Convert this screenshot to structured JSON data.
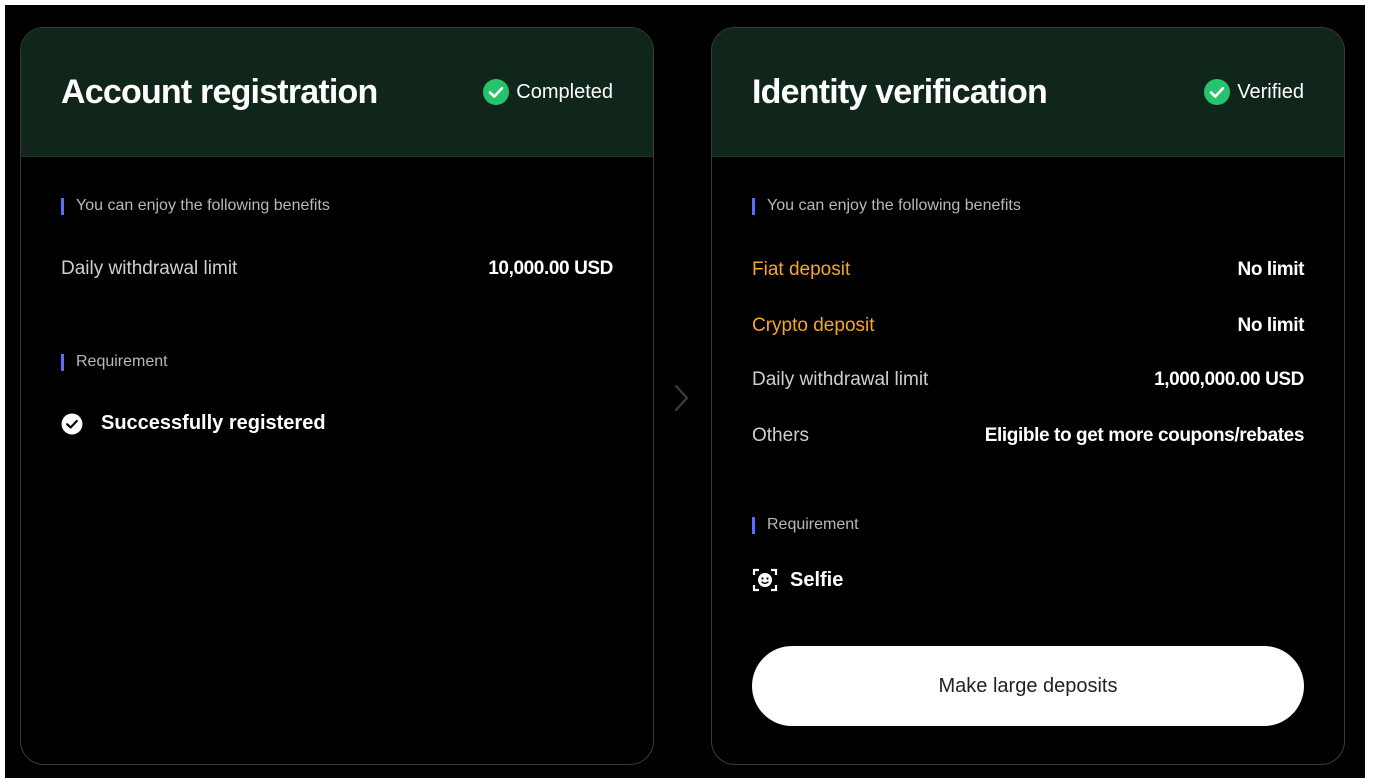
{
  "colors": {
    "header_bg": "#10261a",
    "accent_orange": "#f5a623",
    "accent_bar": "#5b6cff",
    "status_green": "#27c26c"
  },
  "cards": [
    {
      "title": "Account registration",
      "status": "Completed",
      "benefits_heading": "You can enjoy the following benefits",
      "benefits": [
        {
          "label": "Daily withdrawal limit",
          "value": "10,000.00 USD"
        }
      ],
      "requirement_heading": "Requirement",
      "requirement": {
        "label": "Successfully registered",
        "icon": "check-circle-icon"
      }
    },
    {
      "title": "Identity verification",
      "status": "Verified",
      "benefits_heading": "You can enjoy the following benefits",
      "benefits": [
        {
          "label": "Fiat deposit",
          "value": "No limit"
        },
        {
          "label": "Crypto deposit",
          "value": "No limit"
        },
        {
          "label": "Daily withdrawal limit",
          "value": "1,000,000.00 USD"
        },
        {
          "label": "Others",
          "value": "Eligible to get more coupons/rebates"
        }
      ],
      "requirement_heading": "Requirement",
      "requirement": {
        "label": "Selfie",
        "icon": "face-scan-icon"
      },
      "cta_label": "Make large deposits"
    }
  ],
  "separator_icon": "chevron-right-icon"
}
